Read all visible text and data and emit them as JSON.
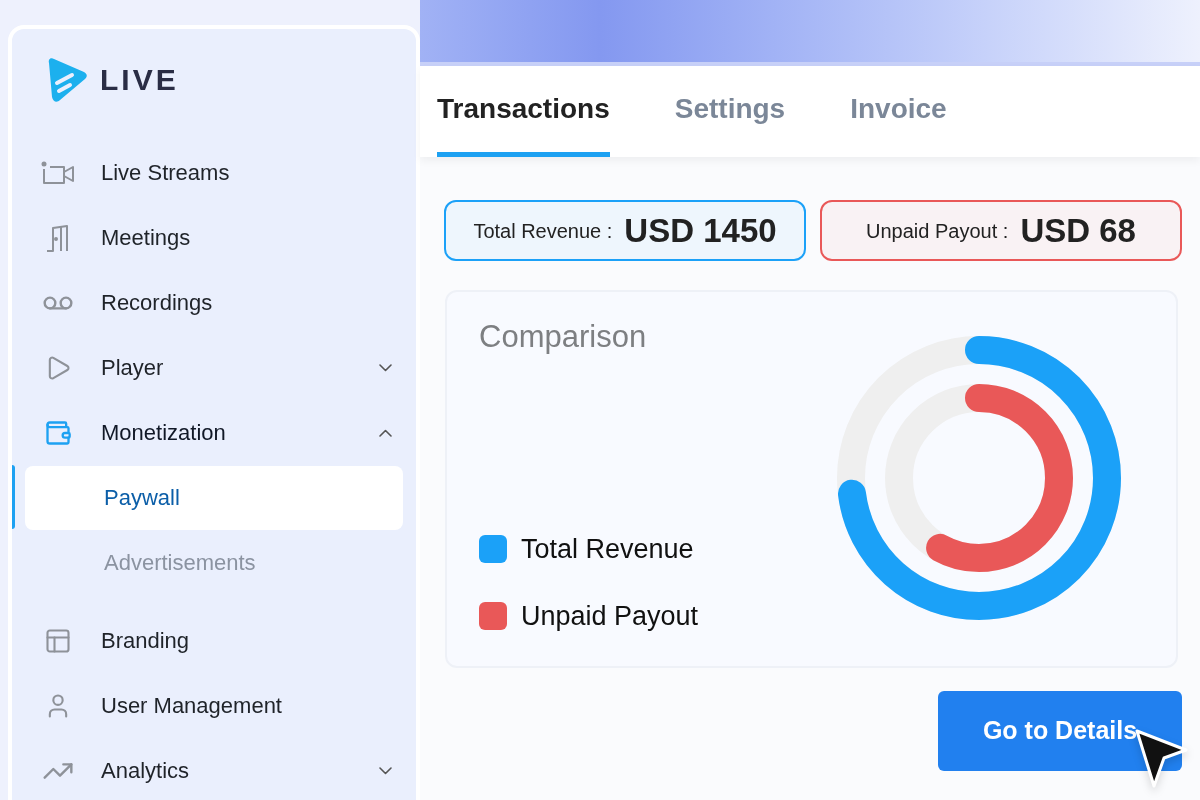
{
  "logo": {
    "text": "LIVE"
  },
  "sidebar": {
    "items": [
      {
        "label": "Live Streams",
        "kind": "link",
        "active": false
      },
      {
        "label": "Meetings",
        "kind": "link",
        "active": false
      },
      {
        "label": "Recordings",
        "kind": "link",
        "active": false
      },
      {
        "label": "Player",
        "kind": "group",
        "active": false,
        "expanded": false
      },
      {
        "label": "Monetization",
        "kind": "group",
        "active": true,
        "expanded": true,
        "children": [
          {
            "label": "Paywall",
            "selected": true
          },
          {
            "label": "Advertisements",
            "selected": false
          }
        ]
      },
      {
        "label": "Branding",
        "kind": "link",
        "active": false
      },
      {
        "label": "User Management",
        "kind": "link",
        "active": false
      },
      {
        "label": "Analytics",
        "kind": "group",
        "active": false,
        "expanded": false
      }
    ]
  },
  "tabs": [
    {
      "label": "Transactions",
      "selected": true
    },
    {
      "label": "Settings",
      "selected": false
    },
    {
      "label": "Invoice",
      "selected": false
    }
  ],
  "stats": [
    {
      "label": "Total Revenue :",
      "value": "USD 1450",
      "color": "#1ba1f8"
    },
    {
      "label": "Unpaid Payout :",
      "value": "USD 68",
      "color": "#e95858"
    }
  ],
  "comparison": {
    "title": "Comparison",
    "series": [
      {
        "name": "Total Revenue",
        "color": "#1ba1f8"
      },
      {
        "name": "Unpaid Payout",
        "color": "#e95858"
      }
    ]
  },
  "button": {
    "label": "Go to Details"
  }
}
